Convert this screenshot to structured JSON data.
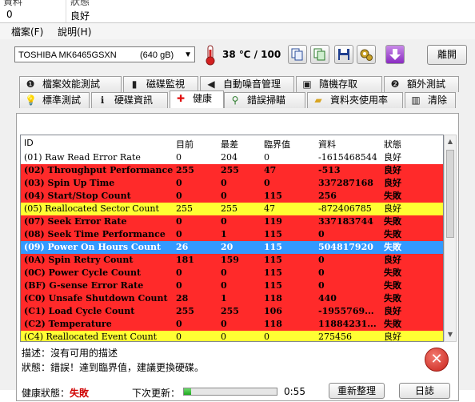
{
  "background_list": {
    "header_col1": "資料",
    "header_col2": "狀態",
    "row_value": "0",
    "row_status": "良好"
  },
  "menu": {
    "file": "檔案(F)",
    "help": "說明(H)"
  },
  "toolbar": {
    "drive_name": "TOSHIBA MK6465GSXN",
    "drive_capacity": "(640 gB)",
    "temperature": "38 ℃ / 100",
    "refresh_label": "離開"
  },
  "tabs_row1": [
    {
      "label": "檔案效能測試",
      "icon": "file-speed-icon"
    },
    {
      "label": "磁碟監視",
      "icon": "chart-icon"
    },
    {
      "label": "自動噪音管理",
      "icon": "speaker-icon"
    },
    {
      "label": "隨機存取",
      "icon": "random-access-icon"
    },
    {
      "label": "額外測試",
      "icon": "extra-test-icon"
    }
  ],
  "tabs_row2": [
    {
      "label": "標準測試",
      "icon": "bulb-icon"
    },
    {
      "label": "硬碟資訊",
      "icon": "info-icon"
    },
    {
      "label": "健康",
      "icon": "health-cross-icon"
    },
    {
      "label": "錯誤掃瞄",
      "icon": "magnifier-icon"
    },
    {
      "label": "資料夾使用率",
      "icon": "folder-icon"
    },
    {
      "label": "清除",
      "icon": "trash-icon"
    }
  ],
  "colors": {
    "red": "#ff2a2a",
    "yellow": "#ffff33",
    "blue": "#3399ff",
    "white": "#ffffff"
  },
  "table": {
    "headers": [
      "ID",
      "目前",
      "最差",
      "臨界值",
      "資料",
      "狀態"
    ],
    "rows": [
      {
        "id": "(01) Raw Read Error Rate",
        "cur": "0",
        "worst": "204",
        "thr": "0",
        "data": "-1615468544",
        "status": "良好",
        "color": "white",
        "bold": false
      },
      {
        "id": "(02) Throughput Performance",
        "cur": "255",
        "worst": "255",
        "thr": "47",
        "data": "-513",
        "status": "良好",
        "color": "red",
        "bold": true
      },
      {
        "id": "(03) Spin Up Time",
        "cur": "0",
        "worst": "0",
        "thr": "0",
        "data": "337287168",
        "status": "良好",
        "color": "red",
        "bold": true
      },
      {
        "id": "(04) Start/Stop Count",
        "cur": "0",
        "worst": "0",
        "thr": "115",
        "data": "256",
        "status": "失敗",
        "color": "red",
        "bold": true
      },
      {
        "id": "(05) Reallocated Sector Count",
        "cur": "255",
        "worst": "255",
        "thr": "47",
        "data": "-872406785",
        "status": "良好",
        "color": "yellow",
        "bold": false
      },
      {
        "id": "(07) Seek Error Rate",
        "cur": "0",
        "worst": "0",
        "thr": "119",
        "data": "337183744",
        "status": "失敗",
        "color": "red",
        "bold": true
      },
      {
        "id": "(08) Seek Time Performance",
        "cur": "0",
        "worst": "1",
        "thr": "115",
        "data": "0",
        "status": "失敗",
        "color": "red",
        "bold": true
      },
      {
        "id": "(09) Power On Hours Count",
        "cur": "26",
        "worst": "20",
        "thr": "115",
        "data": "504817920",
        "status": "失敗",
        "color": "blue",
        "bold": true
      },
      {
        "id": "(0A) Spin Retry Count",
        "cur": "181",
        "worst": "159",
        "thr": "115",
        "data": "0",
        "status": "良好",
        "color": "red",
        "bold": true
      },
      {
        "id": "(0C) Power Cycle Count",
        "cur": "0",
        "worst": "0",
        "thr": "115",
        "data": "0",
        "status": "失敗",
        "color": "red",
        "bold": true
      },
      {
        "id": "(BF) G-sense Error Rate",
        "cur": "0",
        "worst": "0",
        "thr": "115",
        "data": "0",
        "status": "失敗",
        "color": "red",
        "bold": true
      },
      {
        "id": "(C0) Unsafe Shutdown Count",
        "cur": "28",
        "worst": "1",
        "thr": "118",
        "data": "440",
        "status": "失敗",
        "color": "red",
        "bold": true
      },
      {
        "id": "(C1) Load Cycle Count",
        "cur": "255",
        "worst": "255",
        "thr": "106",
        "data": "-1955769...",
        "status": "良好",
        "color": "red",
        "bold": true
      },
      {
        "id": "(C2) Temperature",
        "cur": "0",
        "worst": "0",
        "thr": "118",
        "data": "11884231...",
        "status": "失敗",
        "color": "red",
        "bold": true
      },
      {
        "id": "(C4) Reallocated Event Count",
        "cur": "0",
        "worst": "0",
        "thr": "0",
        "data": "275456",
        "status": "良好",
        "color": "yellow",
        "bold": false
      }
    ]
  },
  "description": {
    "desc_line": "描述：沒有可用的描述",
    "status_line": "狀態：錯誤！達到臨界值，建議更換硬碟。"
  },
  "bottom": {
    "health_label": "健康狀態：",
    "health_value": "失敗",
    "next_update_label": "下次更新：",
    "countdown": "0:55",
    "progress_fraction": 0.08,
    "rescan_button": "重新整理",
    "log_button": "日誌"
  }
}
